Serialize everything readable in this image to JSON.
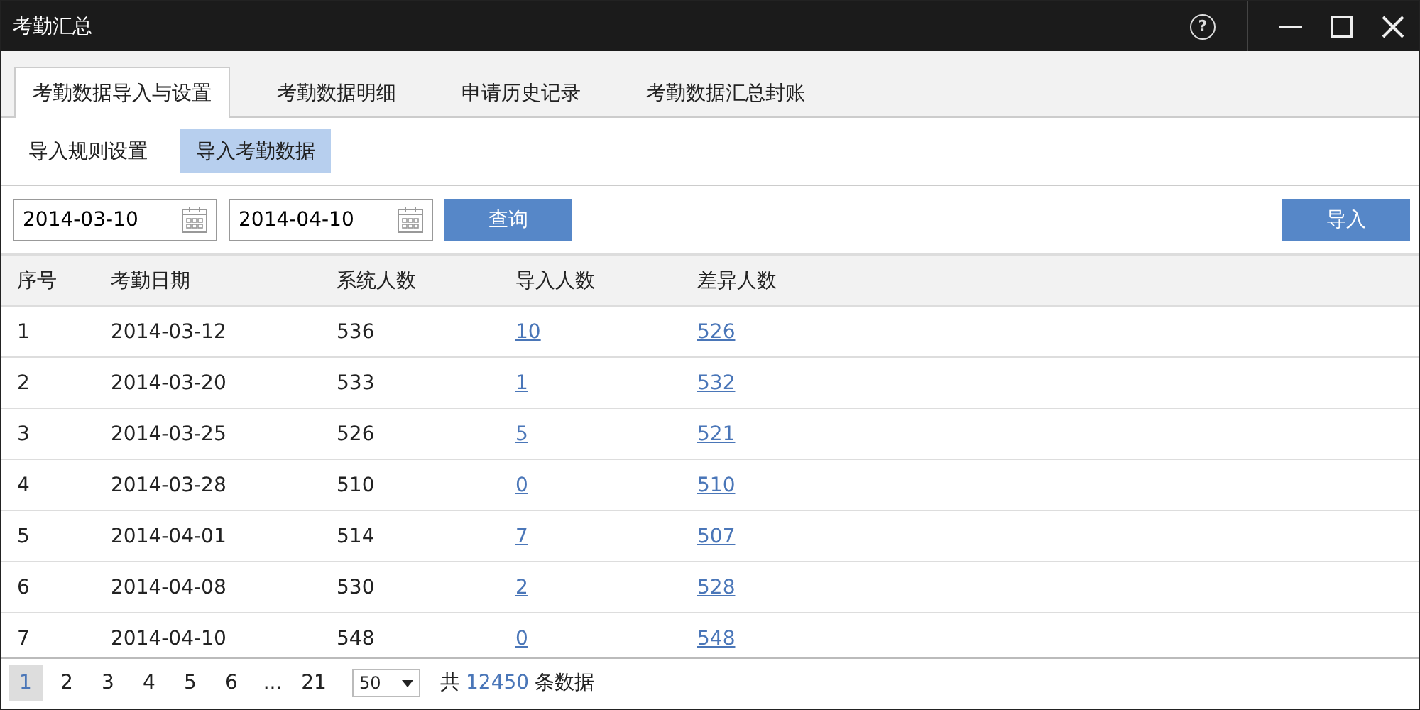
{
  "window": {
    "title": "考勤汇总",
    "help": "?"
  },
  "tabs": [
    {
      "label": "考勤数据导入与设置",
      "selected": true
    },
    {
      "label": "考勤数据明细",
      "selected": false
    },
    {
      "label": "申请历史记录",
      "selected": false
    },
    {
      "label": "考勤数据汇总封账",
      "selected": false
    }
  ],
  "subtabs": [
    {
      "label": "导入规则设置",
      "selected": false
    },
    {
      "label": "导入考勤数据",
      "selected": true
    }
  ],
  "filters": {
    "start_date": "2014-03-10",
    "end_date": "2014-04-10",
    "query_button": "查询",
    "import_button": "导入"
  },
  "table": {
    "columns": [
      "序号",
      "考勤日期",
      "系统人数",
      "导入人数",
      "差异人数"
    ],
    "rows": [
      [
        "1",
        "2014-03-12",
        "536",
        "10",
        "526"
      ],
      [
        "2",
        "2014-03-20",
        "533",
        "1",
        "532"
      ],
      [
        "3",
        "2014-03-25",
        "526",
        "5",
        "521"
      ],
      [
        "4",
        "2014-03-28",
        "510",
        "0",
        "510"
      ],
      [
        "5",
        "2014-04-01",
        "514",
        "7",
        "507"
      ],
      [
        "6",
        "2014-04-08",
        "530",
        "2",
        "528"
      ],
      [
        "7",
        "2014-04-10",
        "548",
        "0",
        "548"
      ]
    ]
  },
  "pagination": {
    "pages": [
      {
        "label": "1",
        "selected": true
      },
      {
        "label": "2",
        "selected": false
      },
      {
        "label": "3",
        "selected": false
      },
      {
        "label": "4",
        "selected": false
      },
      {
        "label": "5",
        "selected": false
      },
      {
        "label": "6",
        "selected": false
      },
      {
        "label": "...",
        "selected": false
      },
      {
        "label": "21",
        "selected": false
      }
    ],
    "page_size": "50",
    "total_prefix": "共",
    "total": "12450",
    "total_suffix": "条数据"
  }
}
